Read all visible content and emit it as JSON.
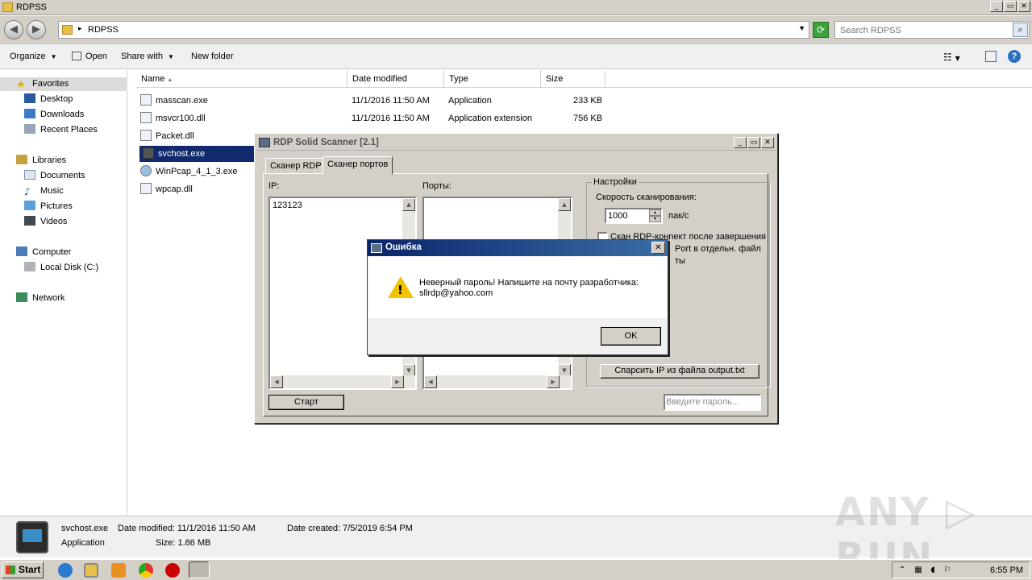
{
  "explorer": {
    "title": "RDPSS",
    "window_controls": {
      "minimize": "_",
      "maximize": "▭",
      "close": "✕"
    },
    "nav_back": "◀",
    "nav_forward": "▶",
    "address_path": "RDPSS",
    "search_placeholder": "Search RDPSS",
    "toolbar": {
      "organize": "Organize",
      "open": "Open",
      "share_with": "Share with",
      "new_folder": "New folder"
    },
    "sidebar": {
      "favorites": "Favorites",
      "desktop": "Desktop",
      "downloads": "Downloads",
      "recent_places": "Recent Places",
      "libraries": "Libraries",
      "documents": "Documents",
      "music": "Music",
      "pictures": "Pictures",
      "videos": "Videos",
      "computer": "Computer",
      "local_disk": "Local Disk (C:)",
      "network": "Network"
    },
    "columns": {
      "name": "Name",
      "date_modified": "Date modified",
      "type": "Type",
      "size": "Size"
    },
    "files": [
      {
        "name": "masscan.exe",
        "date": "11/1/2016 11:50 AM",
        "type": "Application",
        "size": "233 KB"
      },
      {
        "name": "msvcr100.dll",
        "date": "11/1/2016 11:50 AM",
        "type": "Application extension",
        "size": "756 KB"
      },
      {
        "name": "Packet.dll",
        "date": "",
        "type": "",
        "size": ""
      },
      {
        "name": "svchost.exe",
        "date": "",
        "type": "",
        "size": ""
      },
      {
        "name": "WinPcap_4_1_3.exe",
        "date": "",
        "type": "",
        "size": ""
      },
      {
        "name": "wpcap.dll",
        "date": "",
        "type": "",
        "size": ""
      }
    ],
    "details": {
      "filename": "svchost.exe",
      "date_modified": "Date modified: 11/1/2016 11:50 AM",
      "date_created": "Date created: 7/5/2019 6:54 PM",
      "type": "Application",
      "size": "Size: 1.86 MB"
    }
  },
  "rdp_window": {
    "title": "RDP Solid Scanner [2.1]",
    "tabs": [
      "Сканер RDP",
      "Сканер портов"
    ],
    "ip_label": "IP:",
    "ip_value": "123123",
    "ports_label": "Порты:",
    "settings_legend": "Настройки",
    "speed_label": "Скорость сканирования:",
    "speed_value": "1000",
    "speed_unit": "пак/с",
    "check_rdp": "Скан RDP-конnект после завершения",
    "check_port_partial": "Port в отдельн. файл",
    "check_third_partial": "ты",
    "parse_button": "Спарсить IP из файла output.txt",
    "start_button": "Старт",
    "password_placeholder": "Введите пароль..."
  },
  "error_dialog": {
    "title": "Ошибка",
    "message_line1": "Неверный пароль! Напишите на почту разработчика:",
    "message_line2": "sllrdp@yahoo.com",
    "ok_button": "OK"
  },
  "taskbar": {
    "start": "Start",
    "clock": "6:55 PM"
  },
  "watermark": "ANY ▷ RUN"
}
